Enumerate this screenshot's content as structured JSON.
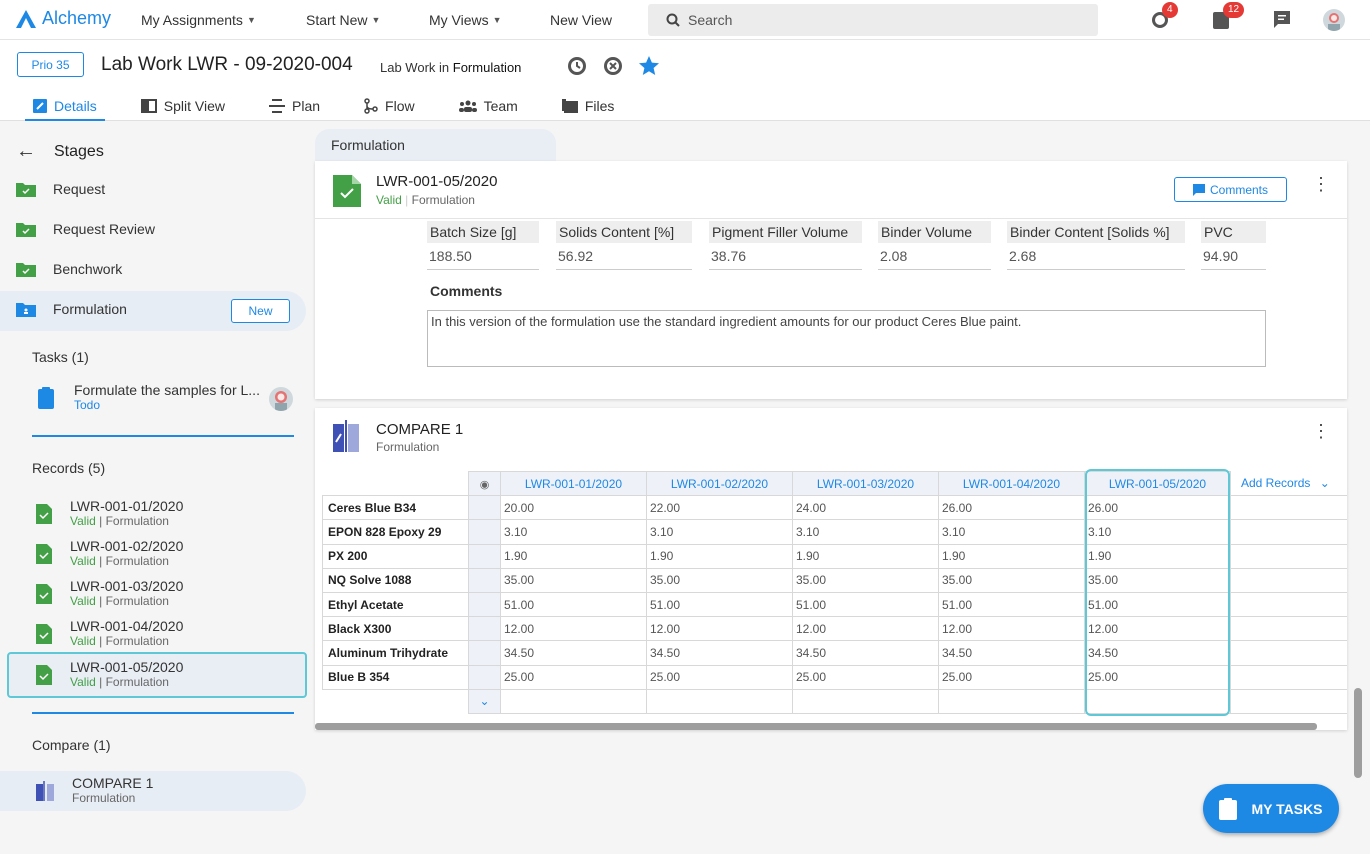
{
  "app": {
    "name": "Alchemy"
  },
  "topnav": {
    "items": [
      "My Assignments",
      "Start New",
      "My Views",
      "New View"
    ],
    "search_placeholder": "Search",
    "badges": {
      "notifications": "4",
      "tasks": "12"
    }
  },
  "header": {
    "priority": "Prio 35",
    "title": "Lab Work LWR - 09-2020-004",
    "subtitle_prefix": "Lab Work in",
    "subtitle_stage": "Formulation",
    "tabs": [
      "Details",
      "Split View",
      "Plan",
      "Flow",
      "Team",
      "Files"
    ]
  },
  "sidebar": {
    "stages_label": "Stages",
    "stages": [
      "Request",
      "Request Review",
      "Benchwork",
      "Formulation"
    ],
    "new_label": "New",
    "tasks_label": "Tasks (1)",
    "task": {
      "title": "Formulate the samples for L...",
      "status": "Todo"
    },
    "records_label": "Records (5)",
    "records": [
      {
        "id": "LWR-001-01/2020",
        "status": "Valid",
        "stage": "Formulation"
      },
      {
        "id": "LWR-001-02/2020",
        "status": "Valid",
        "stage": "Formulation"
      },
      {
        "id": "LWR-001-03/2020",
        "status": "Valid",
        "stage": "Formulation"
      },
      {
        "id": "LWR-001-04/2020",
        "status": "Valid",
        "stage": "Formulation"
      },
      {
        "id": "LWR-001-05/2020",
        "status": "Valid",
        "stage": "Formulation"
      }
    ],
    "compare_label": "Compare (1)",
    "compare": {
      "title": "COMPARE 1",
      "stage": "Formulation"
    }
  },
  "breadcrumb": "Formulation",
  "record_card": {
    "title": "LWR-001-05/2020",
    "status": "Valid",
    "stage": "Formulation",
    "comments_button": "Comments",
    "fields": [
      {
        "label": "Batch Size [g]",
        "value": "188.50"
      },
      {
        "label": "Solids Content [%]",
        "value": "56.92"
      },
      {
        "label": "Pigment Filler Volume",
        "value": "38.76"
      },
      {
        "label": "Binder Volume",
        "value": "2.08"
      },
      {
        "label": "Binder Content [Solids %]",
        "value": "2.68"
      },
      {
        "label": "PVC",
        "value": "94.90"
      }
    ],
    "comments_label": "Comments",
    "comments_text": "In this version of the formulation use the standard ingredient amounts for our product Ceres Blue paint."
  },
  "compare_card": {
    "title": "COMPARE 1",
    "stage": "Formulation",
    "columns": [
      "LWR-001-01/2020",
      "LWR-001-02/2020",
      "LWR-001-03/2020",
      "LWR-001-04/2020",
      "LWR-001-05/2020"
    ],
    "add_records": "Add Records",
    "rows": [
      {
        "label": "Ceres Blue B34",
        "values": [
          "20.00",
          "22.00",
          "24.00",
          "26.00",
          "26.00"
        ]
      },
      {
        "label": "EPON 828 Epoxy 29",
        "values": [
          "3.10",
          "3.10",
          "3.10",
          "3.10",
          "3.10"
        ]
      },
      {
        "label": "PX 200",
        "values": [
          "1.90",
          "1.90",
          "1.90",
          "1.90",
          "1.90"
        ]
      },
      {
        "label": "NQ Solve 1088",
        "values": [
          "35.00",
          "35.00",
          "35.00",
          "35.00",
          "35.00"
        ]
      },
      {
        "label": "Ethyl Acetate",
        "values": [
          "51.00",
          "51.00",
          "51.00",
          "51.00",
          "51.00"
        ]
      },
      {
        "label": "Black X300",
        "values": [
          "12.00",
          "12.00",
          "12.00",
          "12.00",
          "12.00"
        ]
      },
      {
        "label": "Aluminum Trihydrate",
        "values": [
          "34.50",
          "34.50",
          "34.50",
          "34.50",
          "34.50"
        ]
      },
      {
        "label": "Blue B 354",
        "values": [
          "25.00",
          "25.00",
          "25.00",
          "25.00",
          "25.00"
        ]
      }
    ]
  },
  "fab": {
    "label": "MY TASKS"
  }
}
